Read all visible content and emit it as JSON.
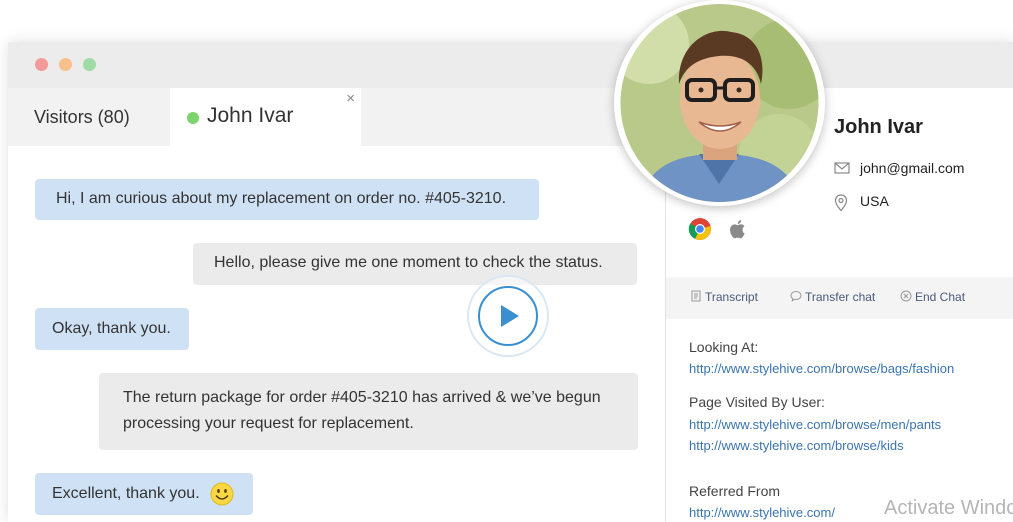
{
  "window": {
    "controls": [
      "close",
      "minimize",
      "maximize"
    ]
  },
  "tabs": {
    "visitors_label": "Visitors (80)",
    "active_name": "John Ivar",
    "close_glyph": "×"
  },
  "messages": [
    {
      "from": "visitor",
      "text": "Hi, I am curious about my replacement on order no. #405-3210."
    },
    {
      "from": "agent",
      "text": "Hello, please give me one moment to check the status."
    },
    {
      "from": "visitor",
      "text": "Okay, thank you."
    },
    {
      "from": "agent",
      "text": "The return package for order #405-3210 has arrived & we’ve begun processing your request for replacement."
    },
    {
      "from": "visitor",
      "text": "Excellent, thank you.",
      "emoji": "smiley-icon"
    }
  ],
  "profile": {
    "name": "John Ivar",
    "email": "john@gmail.com",
    "country": "USA",
    "browser_icons": [
      "chrome-icon",
      "apple-icon"
    ]
  },
  "actions": {
    "transcript": "Transcript",
    "transfer": "Transfer chat",
    "end": "End Chat"
  },
  "details": {
    "looking_at_label": "Looking At:",
    "looking_at_url": "http://www.stylehive.com/browse/bags/fashion",
    "pages_visited_label": "Page Visited By User:",
    "pages_visited": [
      "http://www.stylehive.com/browse/men/pants",
      "http://www.stylehive.com/browse/kids"
    ],
    "referred_label": "Referred From",
    "referred_url": "http://www.stylehive.com/"
  },
  "watermark": "Activate Windo",
  "colors": {
    "visitor_bubble": "#cfe2f5",
    "agent_bubble": "#ebebeb",
    "link": "#3a74b0",
    "online": "#7ed46c",
    "play": "#3a8fd0"
  }
}
